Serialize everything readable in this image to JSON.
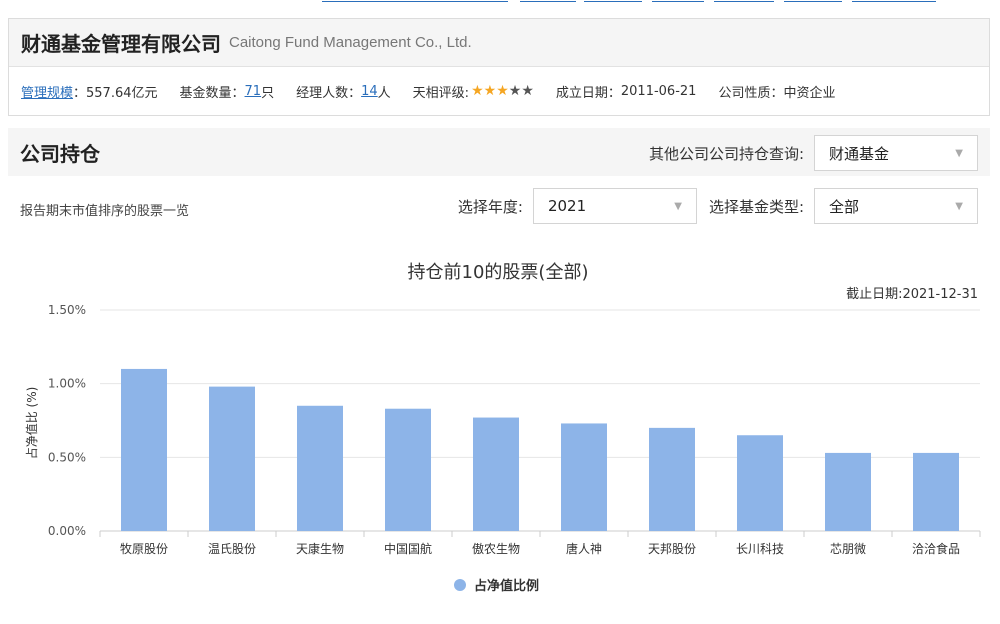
{
  "company": {
    "name": "财通基金管理有限公司",
    "name_en": "Caitong Fund Management Co., Ltd.",
    "info": {
      "scale_label": "管理规模",
      "scale_value": "：557.64亿元",
      "fund_count_label": "基金数量：",
      "fund_count_value": "71",
      "fund_count_unit": "只",
      "manager_count_label": "经理人数：",
      "manager_count_value": "14",
      "manager_count_unit": "人",
      "rating_label": "天相评级:",
      "rating_filled": 3,
      "rating_total": 5,
      "founded_label": "成立日期：",
      "founded_value": "2011-06-21",
      "nature_label": "公司性质：",
      "nature_value": "中资企业"
    }
  },
  "section": {
    "title": "公司持仓",
    "other_company_label": "其他公司公司持仓查询:",
    "other_company_value": "财通基金"
  },
  "filters": {
    "description": "报告期末市值排序的股票一览",
    "year_label": "选择年度:",
    "year_value": "2021",
    "fund_type_label": "选择基金类型:",
    "fund_type_value": "全部"
  },
  "colors": {
    "bar": "#8db4e8",
    "link": "#2a6ebb",
    "star_on": "#f5a623",
    "star_off": "#555555"
  },
  "chart_data": {
    "type": "bar",
    "title": "持仓前10的股票(全部)",
    "subtitle": "截止日期:2021-12-31",
    "ylabel": "占净值比 (%)",
    "ylim": [
      0,
      1.5
    ],
    "yticks": [
      "0.00%",
      "0.50%",
      "1.00%",
      "1.50%"
    ],
    "ytick_values": [
      0,
      0.5,
      1.0,
      1.5
    ],
    "categories": [
      "牧原股份",
      "温氏股份",
      "天康生物",
      "中国国航",
      "傲农生物",
      "唐人神",
      "天邦股份",
      "长川科技",
      "芯朋微",
      "洽洽食品"
    ],
    "series": [
      {
        "name": "占净值比例",
        "values": [
          1.1,
          0.98,
          0.85,
          0.83,
          0.77,
          0.73,
          0.7,
          0.65,
          0.53,
          0.53
        ]
      }
    ],
    "legend_position": "bottom",
    "grid": true
  }
}
